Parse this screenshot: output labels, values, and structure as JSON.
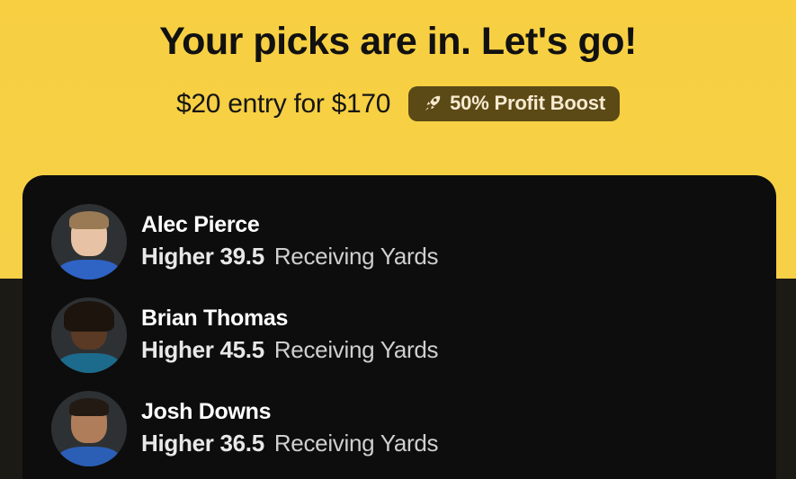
{
  "header": {
    "title": "Your picks are in. Let's go!",
    "entry_text": "$20 entry for $170",
    "boost_label": "50% Profit Boost",
    "boost_icon": "rocket-icon"
  },
  "picks": [
    {
      "name": "Alec Pierce",
      "direction": "Higher",
      "line": "39.5",
      "stat": "Receiving Yards"
    },
    {
      "name": "Brian Thomas",
      "direction": "Higher",
      "line": "45.5",
      "stat": "Receiving Yards"
    },
    {
      "name": "Josh Downs",
      "direction": "Higher",
      "line": "36.5",
      "stat": "Receiving Yards"
    }
  ],
  "colors": {
    "background_yellow": "#f6cf45",
    "card": "#0d0d0d",
    "badge": "#5b4a16"
  }
}
